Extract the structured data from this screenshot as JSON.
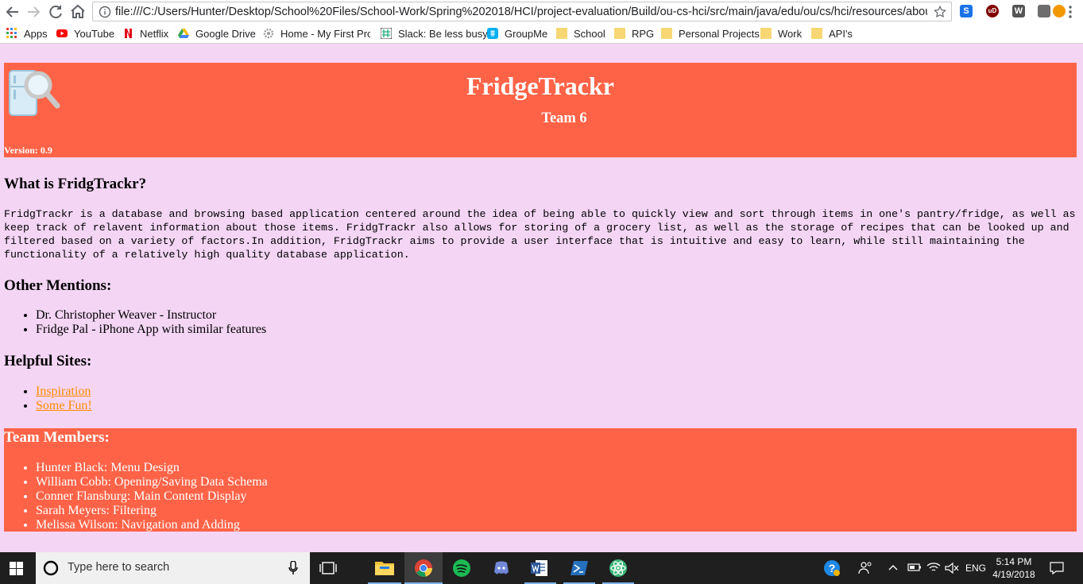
{
  "browser": {
    "url": "file:///C:/Users/Hunter/Desktop/School%20Files/School-Work/Spring%202018/HCI/project-evaluation/Build/ou-cs-hci/src/main/java/edu/ou/cs/hci/resources/about...",
    "extensions": [
      "S",
      "uD",
      "W",
      "",
      ""
    ],
    "bookmarks": [
      "Apps",
      "YouTube",
      "Netflix",
      "Google Drive",
      "Home - My First Proj",
      "Slack: Be less busy",
      "GroupMe",
      "School",
      "RPG",
      "Personal Projects",
      "Work",
      "API's"
    ]
  },
  "header": {
    "title": "FridgeTrackr",
    "team": "Team 6",
    "version": "Version: 0.9"
  },
  "about": {
    "heading": "What is FridgTrackr?",
    "text": "FridgTrackr is a database and browsing based application centered around the idea of being able to quickly view and sort through items in one's pantry/fridge, as well as keep track of relavent information about those items. FridgTrackr also allows for storing of a grocery list, as well as the storage of recipes that can be looked up and filtered based on a variety of factors.In addition, FridgTrackr aims to provide a user interface that is intuitive and easy to learn, while still maintaining the functionality of a relatively high quality database application."
  },
  "mentions": {
    "heading": "Other Mentions:",
    "items": [
      "Dr. Christopher Weaver - Instructor",
      "Fridge Pal - iPhone App with similar features"
    ]
  },
  "sites": {
    "heading": "Helpful Sites:",
    "items": [
      "Inspiration",
      "Some Fun!"
    ]
  },
  "team": {
    "heading": "Team Members:",
    "members": [
      "Hunter Black: Menu Design",
      "William Cobb: Opening/Saving Data Schema",
      "Conner Flansburg: Main Content Display",
      "Sarah Meyers: Filtering",
      "Melissa Wilson: Navigation and Adding"
    ]
  },
  "taskbar": {
    "search_placeholder": "Type here to search",
    "language": "ENG",
    "time": "5:14 PM",
    "date": "4/19/2018"
  },
  "colors": {
    "page_bg": "#f4d5f4",
    "banner": "#ff6347",
    "link": "#ff8c00"
  }
}
